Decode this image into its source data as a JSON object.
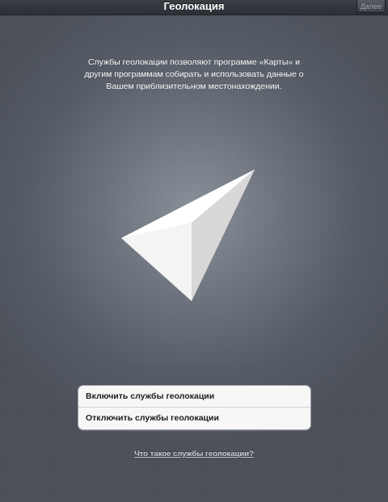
{
  "navbar": {
    "title": "Геолокация",
    "next_label": "Далее"
  },
  "description": "Службы геолокации позволяют программе «Карты» и другим программам собирать и использовать данные о Вашем приблизительном местонахождении.",
  "options": {
    "enable_label": "Включить службы геолокации",
    "disable_label": "Отключить службы геолокации"
  },
  "help_link": "Что такое службы геолокации?",
  "icon": "location-arrow-icon"
}
